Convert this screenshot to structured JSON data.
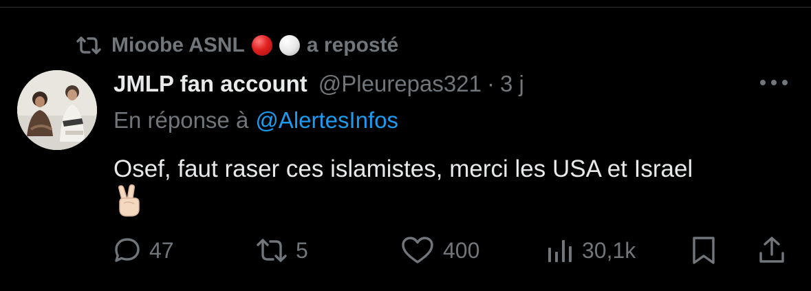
{
  "repost": {
    "user": "Mioobe ASNL",
    "suffix": "a reposté"
  },
  "tweet": {
    "display_name": "JMLP fan account",
    "handle": "@Pleurepas321",
    "separator": "·",
    "time": "3 j",
    "reply_prefix": "En réponse à",
    "reply_to": "@AlertesInfos",
    "text": "Osef, faut raser ces islamistes, merci les USA et Israel"
  },
  "actions": {
    "replies": "47",
    "reposts": "5",
    "likes": "400",
    "views": "30,1k"
  },
  "colors": {
    "background": "#000000",
    "primary_text": "#e7e9ea",
    "secondary_text": "#71767b",
    "link": "#1d9bf0"
  }
}
